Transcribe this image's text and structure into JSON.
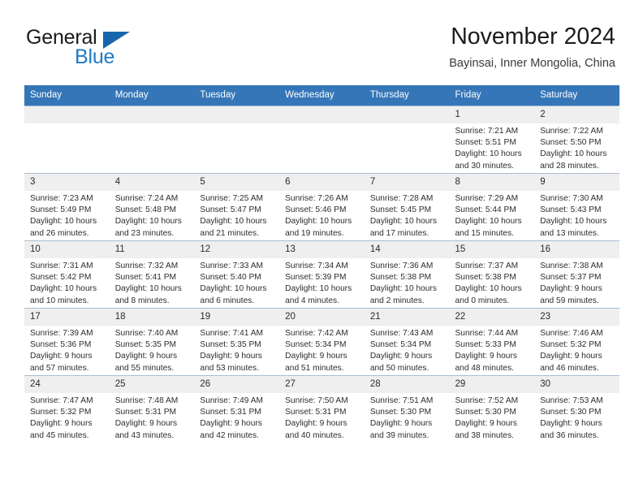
{
  "brand": {
    "word1": "General",
    "word2": "Blue",
    "accent_color": "#1f7ac4",
    "triangle_color": "#1666ad"
  },
  "header": {
    "month_title": "November 2024",
    "location": "Bayinsai, Inner Mongolia, China",
    "header_bg_color": "#3576b8"
  },
  "calendar": {
    "weekday_headers": [
      "Sunday",
      "Monday",
      "Tuesday",
      "Wednesday",
      "Thursday",
      "Friday",
      "Saturday"
    ],
    "weeks": [
      [
        {
          "day": "",
          "blank": true
        },
        {
          "day": "",
          "blank": true
        },
        {
          "day": "",
          "blank": true
        },
        {
          "day": "",
          "blank": true
        },
        {
          "day": "",
          "blank": true
        },
        {
          "day": "1",
          "sunrise": "Sunrise: 7:21 AM",
          "sunset": "Sunset: 5:51 PM",
          "daylight": "Daylight: 10 hours and 30 minutes."
        },
        {
          "day": "2",
          "sunrise": "Sunrise: 7:22 AM",
          "sunset": "Sunset: 5:50 PM",
          "daylight": "Daylight: 10 hours and 28 minutes."
        }
      ],
      [
        {
          "day": "3",
          "sunrise": "Sunrise: 7:23 AM",
          "sunset": "Sunset: 5:49 PM",
          "daylight": "Daylight: 10 hours and 26 minutes."
        },
        {
          "day": "4",
          "sunrise": "Sunrise: 7:24 AM",
          "sunset": "Sunset: 5:48 PM",
          "daylight": "Daylight: 10 hours and 23 minutes."
        },
        {
          "day": "5",
          "sunrise": "Sunrise: 7:25 AM",
          "sunset": "Sunset: 5:47 PM",
          "daylight": "Daylight: 10 hours and 21 minutes."
        },
        {
          "day": "6",
          "sunrise": "Sunrise: 7:26 AM",
          "sunset": "Sunset: 5:46 PM",
          "daylight": "Daylight: 10 hours and 19 minutes."
        },
        {
          "day": "7",
          "sunrise": "Sunrise: 7:28 AM",
          "sunset": "Sunset: 5:45 PM",
          "daylight": "Daylight: 10 hours and 17 minutes."
        },
        {
          "day": "8",
          "sunrise": "Sunrise: 7:29 AM",
          "sunset": "Sunset: 5:44 PM",
          "daylight": "Daylight: 10 hours and 15 minutes."
        },
        {
          "day": "9",
          "sunrise": "Sunrise: 7:30 AM",
          "sunset": "Sunset: 5:43 PM",
          "daylight": "Daylight: 10 hours and 13 minutes."
        }
      ],
      [
        {
          "day": "10",
          "sunrise": "Sunrise: 7:31 AM",
          "sunset": "Sunset: 5:42 PM",
          "daylight": "Daylight: 10 hours and 10 minutes."
        },
        {
          "day": "11",
          "sunrise": "Sunrise: 7:32 AM",
          "sunset": "Sunset: 5:41 PM",
          "daylight": "Daylight: 10 hours and 8 minutes."
        },
        {
          "day": "12",
          "sunrise": "Sunrise: 7:33 AM",
          "sunset": "Sunset: 5:40 PM",
          "daylight": "Daylight: 10 hours and 6 minutes."
        },
        {
          "day": "13",
          "sunrise": "Sunrise: 7:34 AM",
          "sunset": "Sunset: 5:39 PM",
          "daylight": "Daylight: 10 hours and 4 minutes."
        },
        {
          "day": "14",
          "sunrise": "Sunrise: 7:36 AM",
          "sunset": "Sunset: 5:38 PM",
          "daylight": "Daylight: 10 hours and 2 minutes."
        },
        {
          "day": "15",
          "sunrise": "Sunrise: 7:37 AM",
          "sunset": "Sunset: 5:38 PM",
          "daylight": "Daylight: 10 hours and 0 minutes."
        },
        {
          "day": "16",
          "sunrise": "Sunrise: 7:38 AM",
          "sunset": "Sunset: 5:37 PM",
          "daylight": "Daylight: 9 hours and 59 minutes."
        }
      ],
      [
        {
          "day": "17",
          "sunrise": "Sunrise: 7:39 AM",
          "sunset": "Sunset: 5:36 PM",
          "daylight": "Daylight: 9 hours and 57 minutes."
        },
        {
          "day": "18",
          "sunrise": "Sunrise: 7:40 AM",
          "sunset": "Sunset: 5:35 PM",
          "daylight": "Daylight: 9 hours and 55 minutes."
        },
        {
          "day": "19",
          "sunrise": "Sunrise: 7:41 AM",
          "sunset": "Sunset: 5:35 PM",
          "daylight": "Daylight: 9 hours and 53 minutes."
        },
        {
          "day": "20",
          "sunrise": "Sunrise: 7:42 AM",
          "sunset": "Sunset: 5:34 PM",
          "daylight": "Daylight: 9 hours and 51 minutes."
        },
        {
          "day": "21",
          "sunrise": "Sunrise: 7:43 AM",
          "sunset": "Sunset: 5:34 PM",
          "daylight": "Daylight: 9 hours and 50 minutes."
        },
        {
          "day": "22",
          "sunrise": "Sunrise: 7:44 AM",
          "sunset": "Sunset: 5:33 PM",
          "daylight": "Daylight: 9 hours and 48 minutes."
        },
        {
          "day": "23",
          "sunrise": "Sunrise: 7:46 AM",
          "sunset": "Sunset: 5:32 PM",
          "daylight": "Daylight: 9 hours and 46 minutes."
        }
      ],
      [
        {
          "day": "24",
          "sunrise": "Sunrise: 7:47 AM",
          "sunset": "Sunset: 5:32 PM",
          "daylight": "Daylight: 9 hours and 45 minutes."
        },
        {
          "day": "25",
          "sunrise": "Sunrise: 7:48 AM",
          "sunset": "Sunset: 5:31 PM",
          "daylight": "Daylight: 9 hours and 43 minutes."
        },
        {
          "day": "26",
          "sunrise": "Sunrise: 7:49 AM",
          "sunset": "Sunset: 5:31 PM",
          "daylight": "Daylight: 9 hours and 42 minutes."
        },
        {
          "day": "27",
          "sunrise": "Sunrise: 7:50 AM",
          "sunset": "Sunset: 5:31 PM",
          "daylight": "Daylight: 9 hours and 40 minutes."
        },
        {
          "day": "28",
          "sunrise": "Sunrise: 7:51 AM",
          "sunset": "Sunset: 5:30 PM",
          "daylight": "Daylight: 9 hours and 39 minutes."
        },
        {
          "day": "29",
          "sunrise": "Sunrise: 7:52 AM",
          "sunset": "Sunset: 5:30 PM",
          "daylight": "Daylight: 9 hours and 38 minutes."
        },
        {
          "day": "30",
          "sunrise": "Sunrise: 7:53 AM",
          "sunset": "Sunset: 5:30 PM",
          "daylight": "Daylight: 9 hours and 36 minutes."
        }
      ]
    ]
  }
}
